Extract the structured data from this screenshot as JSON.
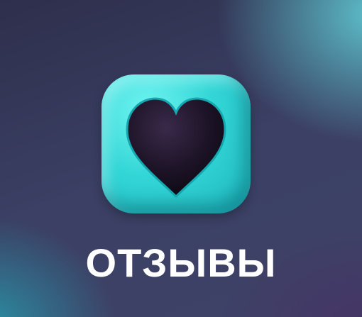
{
  "title": "ОТЗЫВЫ",
  "icon": {
    "name": "heart-icon",
    "tile_color": "#33d6d6",
    "heart_color": "#1e1428"
  }
}
